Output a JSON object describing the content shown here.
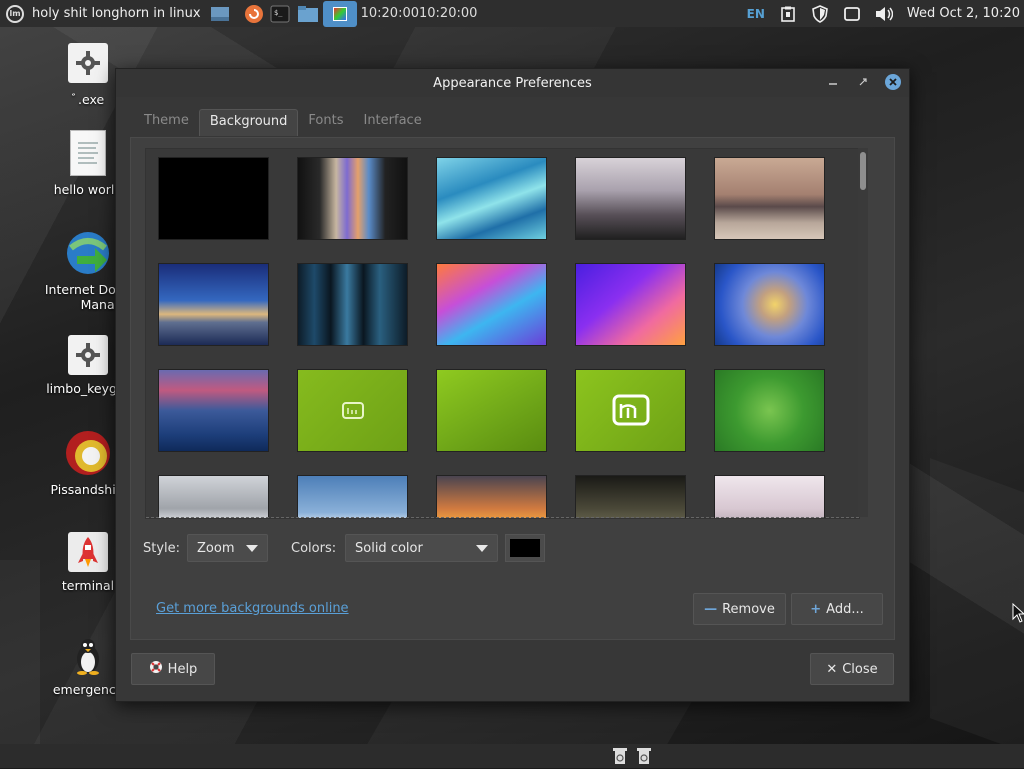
{
  "top_panel": {
    "window_title": "holy shit longhorn in linux",
    "clock_text": "10:20:0010:20:00",
    "language": "EN",
    "datetime": "Wed Oct  2, 10:20"
  },
  "desktop_icons": [
    {
      "label": "ﾞ.exe"
    },
    {
      "label": "hello world"
    },
    {
      "label": "Internet Download Manager",
      "line1": "Internet Dowr",
      "line2": "Manager"
    },
    {
      "label": "limbo_keyger"
    },
    {
      "label": "Pissandshitt"
    },
    {
      "label": "terminal"
    },
    {
      "label": "emergency"
    }
  ],
  "dialog": {
    "title": "Appearance Preferences",
    "tabs": [
      {
        "label": "Theme"
      },
      {
        "label": "Background"
      },
      {
        "label": "Fonts"
      },
      {
        "label": "Interface"
      }
    ],
    "active_tab": "Background",
    "style_label": "Style:",
    "style_value": "Zoom",
    "colors_label": "Colors:",
    "colors_value": "Solid color",
    "solid_color": "#000000",
    "link_text": "Get more backgrounds online",
    "remove_label": "Remove",
    "add_label": "Add...",
    "help_label": "Help",
    "close_label": "Close"
  },
  "colors": {
    "accent": "#5aa0d8",
    "panel": "#2e2e2e",
    "dialog_bg": "#373737"
  }
}
